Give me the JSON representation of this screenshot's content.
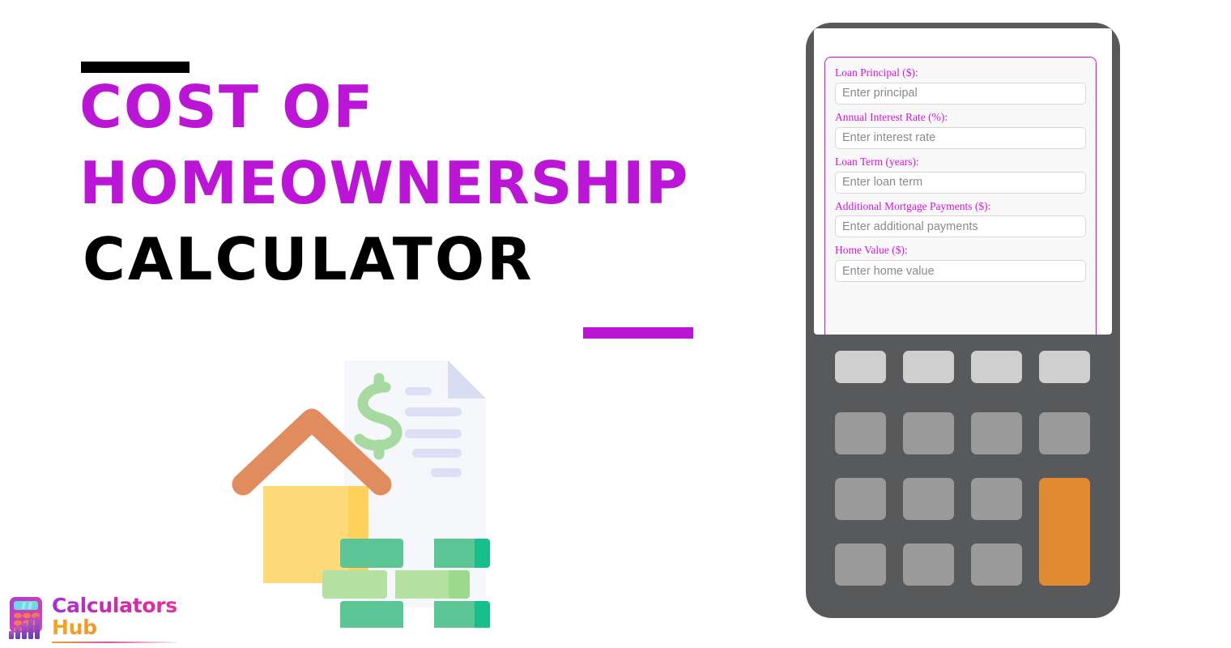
{
  "page": {
    "background_color": "#ffffff"
  },
  "hero": {
    "title_lines": [
      "COST OF",
      "HOMEOWNERSHIP",
      "CALCULATOR"
    ],
    "title_color_primary": "#bb16d6",
    "title_color_secondary": "#000000",
    "accent_bar_top_color": "#000000",
    "accent_bar_bottom_color": "#bb16d6"
  },
  "illustration": {
    "name": "house-document-money-illustration",
    "document_color": "#f5f7fa",
    "document_fold_color": "#d9ddf2",
    "dollar_sign_color": "#a7daa1",
    "line_color": "#dde0f5",
    "house_body_color": "#ffda79",
    "house_body_shade_color": "#ffd15c",
    "roof_color": "#e08c5f",
    "money_color": "#5bc596",
    "money_edge_color": "#17bf8a",
    "money_light_color": "#b3e2a2",
    "money_light_edge_color": "#9bd98c"
  },
  "calculator": {
    "body_color": "#58595b",
    "screen_color": "#ffffff",
    "panel_border_color": "#d010d0",
    "panel_background_color": "#f8f8f8",
    "form": {
      "fields": [
        {
          "label": "Loan Principal ($):",
          "placeholder": "Enter principal",
          "value": ""
        },
        {
          "label": "Annual Interest Rate (%):",
          "placeholder": "Enter interest rate",
          "value": ""
        },
        {
          "label": "Loan Term (years):",
          "placeholder": "Enter loan term",
          "value": ""
        },
        {
          "label": "Additional Mortgage Payments ($):",
          "placeholder": "Enter additional payments",
          "value": ""
        },
        {
          "label": "Home Value ($):",
          "placeholder": "Enter home value",
          "value": ""
        }
      ]
    },
    "keypad": {
      "light_key_color": "#cfcfcf",
      "normal_key_color": "#9a9a9a",
      "accent_key_color": "#e08b32",
      "rows": 4,
      "columns": 4,
      "keys": [
        {
          "name": "key-r1c1",
          "style": "light"
        },
        {
          "name": "key-r1c2",
          "style": "light"
        },
        {
          "name": "key-r1c3",
          "style": "light"
        },
        {
          "name": "key-r1c4",
          "style": "light"
        },
        {
          "name": "key-r2c1",
          "style": "normal"
        },
        {
          "name": "key-r2c2",
          "style": "normal"
        },
        {
          "name": "key-r2c3",
          "style": "normal"
        },
        {
          "name": "key-r2c4",
          "style": "normal"
        },
        {
          "name": "key-r3c1",
          "style": "normal"
        },
        {
          "name": "key-r3c2",
          "style": "normal"
        },
        {
          "name": "key-r3c3",
          "style": "normal"
        },
        {
          "name": "key-equals",
          "style": "accent"
        },
        {
          "name": "key-r4c1",
          "style": "normal"
        },
        {
          "name": "key-r4c2",
          "style": "normal"
        },
        {
          "name": "key-r4c3",
          "style": "normal"
        }
      ]
    }
  },
  "logo": {
    "word_1": "Calculators",
    "word_2": "Hub",
    "word_1_color": "#c02bbf",
    "word_2_color": "#f5a623",
    "icon_name": "calculator-bar-chart-icon"
  }
}
